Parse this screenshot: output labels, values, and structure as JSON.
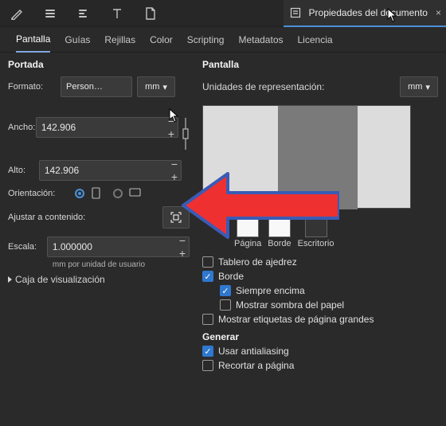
{
  "panelTabTitle": "Propiedades del documento",
  "subTabs": [
    "Pantalla",
    "Guías",
    "Rejillas",
    "Color",
    "Scripting",
    "Metadatos",
    "Licencia"
  ],
  "activeSubTab": 0,
  "left": {
    "section": "Portada",
    "format": {
      "label": "Formato:",
      "value": "Person…",
      "unit": "mm"
    },
    "width": {
      "label": "Ancho:",
      "value": "142.906"
    },
    "height": {
      "label": "Alto:",
      "value": "142.906"
    },
    "orientation": {
      "label": "Orientación:"
    },
    "fitContent": {
      "label": "Ajustar a contenido:"
    },
    "scale": {
      "label": "Escala:",
      "value": "1.000000"
    },
    "scaleUnitNote": "mm por unidad de usuario",
    "displayBox": "Caja de visualización"
  },
  "right": {
    "section": "Pantalla",
    "reprLabel": "Unidades de representación:",
    "reprUnit": "mm",
    "previewButtons": {
      "page": "Página",
      "border": "Borde",
      "desktop": "Escritorio"
    },
    "checks": {
      "chess": {
        "text": "Tablero de ajedrez",
        "on": false
      },
      "border": {
        "text": "Borde",
        "on": true
      },
      "alwaysTop": {
        "text": "Siempre encima",
        "on": true
      },
      "paperShadow": {
        "text": "Mostrar sombra del papel",
        "on": false
      },
      "bigLabels": {
        "text": "Mostrar etiquetas de página grandes",
        "on": false
      }
    },
    "genSection": "Generar",
    "genChecks": {
      "antialias": {
        "text": "Usar antialiasing",
        "on": true
      },
      "clip": {
        "text": "Recortar a página",
        "on": false
      }
    }
  }
}
